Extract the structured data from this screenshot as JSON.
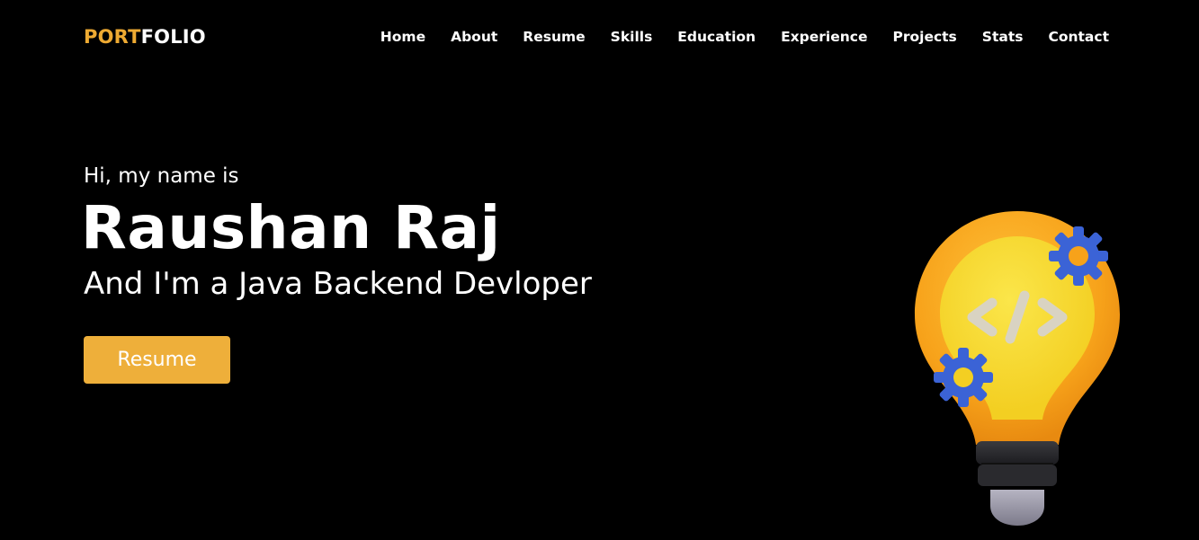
{
  "logo": {
    "accent_text": "PORT",
    "rest_text": "FOLIO",
    "accent_color": "#eeaa32"
  },
  "nav": {
    "items": [
      {
        "label": "Home"
      },
      {
        "label": "About"
      },
      {
        "label": "Resume"
      },
      {
        "label": "Skills"
      },
      {
        "label": "Education"
      },
      {
        "label": "Experience"
      },
      {
        "label": "Projects"
      },
      {
        "label": "Stats"
      },
      {
        "label": "Contact"
      }
    ]
  },
  "hero": {
    "greeting": "Hi, my name is",
    "name": "Raushan Raj",
    "role": "And I'm a Java Backend Devloper",
    "button_label": "Resume",
    "button_color": "#eeaf3a"
  },
  "illustration": {
    "icon": "lightbulb-code-icon",
    "code_glyph": "</>"
  }
}
